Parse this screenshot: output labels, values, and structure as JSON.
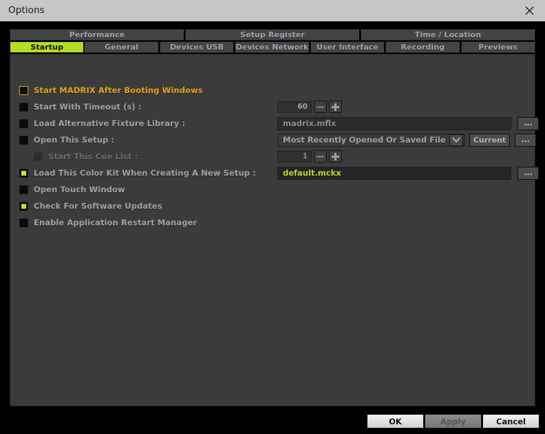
{
  "window": {
    "title": "Options",
    "close_icon": "close-icon"
  },
  "tabs_top": [
    {
      "label": "Performance"
    },
    {
      "label": "Setup Register"
    },
    {
      "label": "Time / Location"
    }
  ],
  "tabs_main": [
    {
      "label": "Startup",
      "active": true
    },
    {
      "label": "General",
      "active": false
    },
    {
      "label": "Devices USB",
      "active": false
    },
    {
      "label": "Devices Network",
      "active": false
    },
    {
      "label": "User Interface",
      "active": false
    },
    {
      "label": "Recording",
      "active": false
    },
    {
      "label": "Previews",
      "active": false
    }
  ],
  "options": {
    "row1": {
      "label": "Start MADRIX After Booting Windows",
      "checked": false
    },
    "row2": {
      "label": "Start With Timeout (s) :",
      "checked": false,
      "value": "60"
    },
    "row3": {
      "label": "Load Alternative Fixture Library :",
      "checked": false,
      "value": "madrix.mflx",
      "browse_label": "..."
    },
    "row4": {
      "label": "Open This Setup :",
      "checked": false,
      "dropdown_value": "Most Recently Opened Or Saved File",
      "current_label": "Current",
      "browse_label": "..."
    },
    "row5": {
      "label": "Start This Cue List :",
      "checked": false,
      "value": "1"
    },
    "row6": {
      "label": "Load This Color Kit When Creating A New Setup :",
      "checked": true,
      "value": "default.mckx",
      "browse_label": "..."
    },
    "row7": {
      "label": "Open Touch Window",
      "checked": false
    },
    "row8": {
      "label": "Check For Software Updates",
      "checked": true
    },
    "row9": {
      "label": "Enable Application Restart Manager",
      "checked": false
    }
  },
  "footer": {
    "ok_label": "OK",
    "apply_label": "Apply",
    "cancel_label": "Cancel"
  },
  "colors": {
    "accent_green": "#b5dd22",
    "highlight_amber": "#e0a51c",
    "panel_bg": "#3b3b3b",
    "titlebar_bg": "#c6c6c6"
  }
}
